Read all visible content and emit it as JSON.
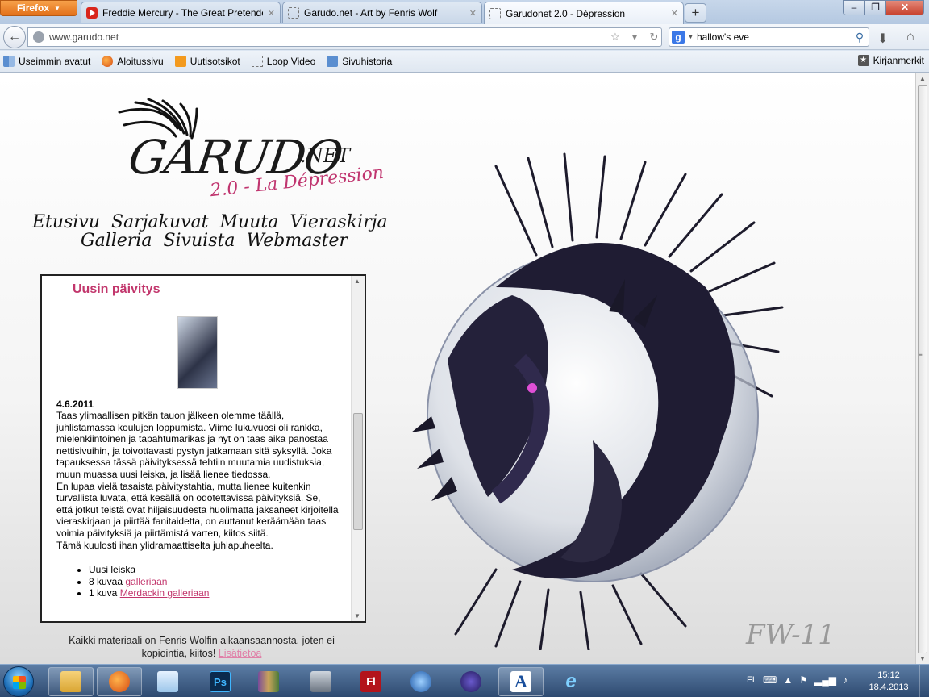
{
  "browser": {
    "menu_button": "Firefox",
    "tabs": [
      {
        "label": "Freddie Mercury - The Great Pretende...",
        "active": false
      },
      {
        "label": "Garudo.net - Art by Fenris Wolf",
        "active": false
      },
      {
        "label": "Garudonet 2.0 - Dépression",
        "active": true
      }
    ],
    "new_tab": "+",
    "url": "www.garudo.net",
    "search_value": "hallow's eve",
    "search_engine_icon": "g"
  },
  "bookmarks": [
    {
      "label": "Useimmin avatut",
      "icon": "bar-icon"
    },
    {
      "label": "Aloitussivu",
      "icon": "firefox-icon"
    },
    {
      "label": "Uutisotsikot",
      "icon": "rss-icon"
    },
    {
      "label": "Loop Video",
      "icon": "blank-page-icon"
    },
    {
      "label": "Sivuhistoria",
      "icon": "history-icon"
    }
  ],
  "bookmarks_menu": "Kirjanmerkit",
  "site": {
    "logo": {
      "main": "GARUDO",
      "net": ".NET",
      "sub": "2.0 - La Dépression"
    },
    "nav": {
      "row1": [
        "Etusivu",
        "Sarjakuvat",
        "Muuta",
        "Vieraskirja"
      ],
      "row2": [
        "Galleria",
        "Sivuista",
        "Webmaster"
      ]
    },
    "news": {
      "title": "Uusin päivitys",
      "date": "4.6.2011",
      "body": "Taas ylimaallisen pitkän tauon jälkeen olemme täällä, juhlistamassa koulujen loppumista. Viime lukuvuosi oli rankka, mielenkiintoinen ja tapahtumarikas ja nyt on taas aika panostaa nettisivuihin, ja toivottavasti pystyn jatkamaan sitä syksyllä. Joka tapauksessa tässä päivityksessä tehtiin muutamia uudistuksia, muun muassa uusi leiska, ja lisää lienee tiedossa.",
      "body2": "En lupaa vielä tasaista päivitystahtia, mutta lienee kuitenkin turvallista luvata, että kesällä on odotettavissa päivityksiä. Se, että jotkut teistä ovat hiljaisuudesta huolimatta jaksaneet kirjoitella vieraskirjaan ja piirtää fanitaidetta, on auttanut keräämään taas voimia päivityksiä ja piirtämistä varten, kiitos siitä.",
      "body3": "Tämä kuulosti ihan ylidramaattiselta juhlapuheelta.",
      "items": [
        {
          "text": "Uusi leiska",
          "link": ""
        },
        {
          "text": "8 kuvaa ",
          "link": "galleriaan"
        },
        {
          "text": "1 kuva ",
          "link": "Merdackin galleriaan"
        }
      ]
    },
    "footer": {
      "text": "Kaikki materiaali on Fenris Wolfin aikaansaannosta, joten ei kopiointia, kiitos!",
      "link": "Lisätietoa"
    },
    "signature": "FW-11"
  },
  "taskbar": {
    "apps": [
      {
        "name": "explorer",
        "label": ""
      },
      {
        "name": "firefox",
        "label": ""
      },
      {
        "name": "notepad",
        "label": ""
      },
      {
        "name": "photoshop",
        "label": "Ps"
      },
      {
        "name": "winrar",
        "label": ""
      },
      {
        "name": "printer",
        "label": ""
      },
      {
        "name": "flash",
        "label": "Fl"
      },
      {
        "name": "itunes",
        "label": ""
      },
      {
        "name": "eclipse",
        "label": ""
      },
      {
        "name": "font-viewer",
        "label": "A"
      },
      {
        "name": "internet-explorer",
        "label": "e"
      }
    ],
    "lang": "FI",
    "time": "15:12",
    "date": "18.4.2013"
  },
  "colors": {
    "accent_pink": "#c2366c",
    "firefox_orange": "#e2701a"
  }
}
